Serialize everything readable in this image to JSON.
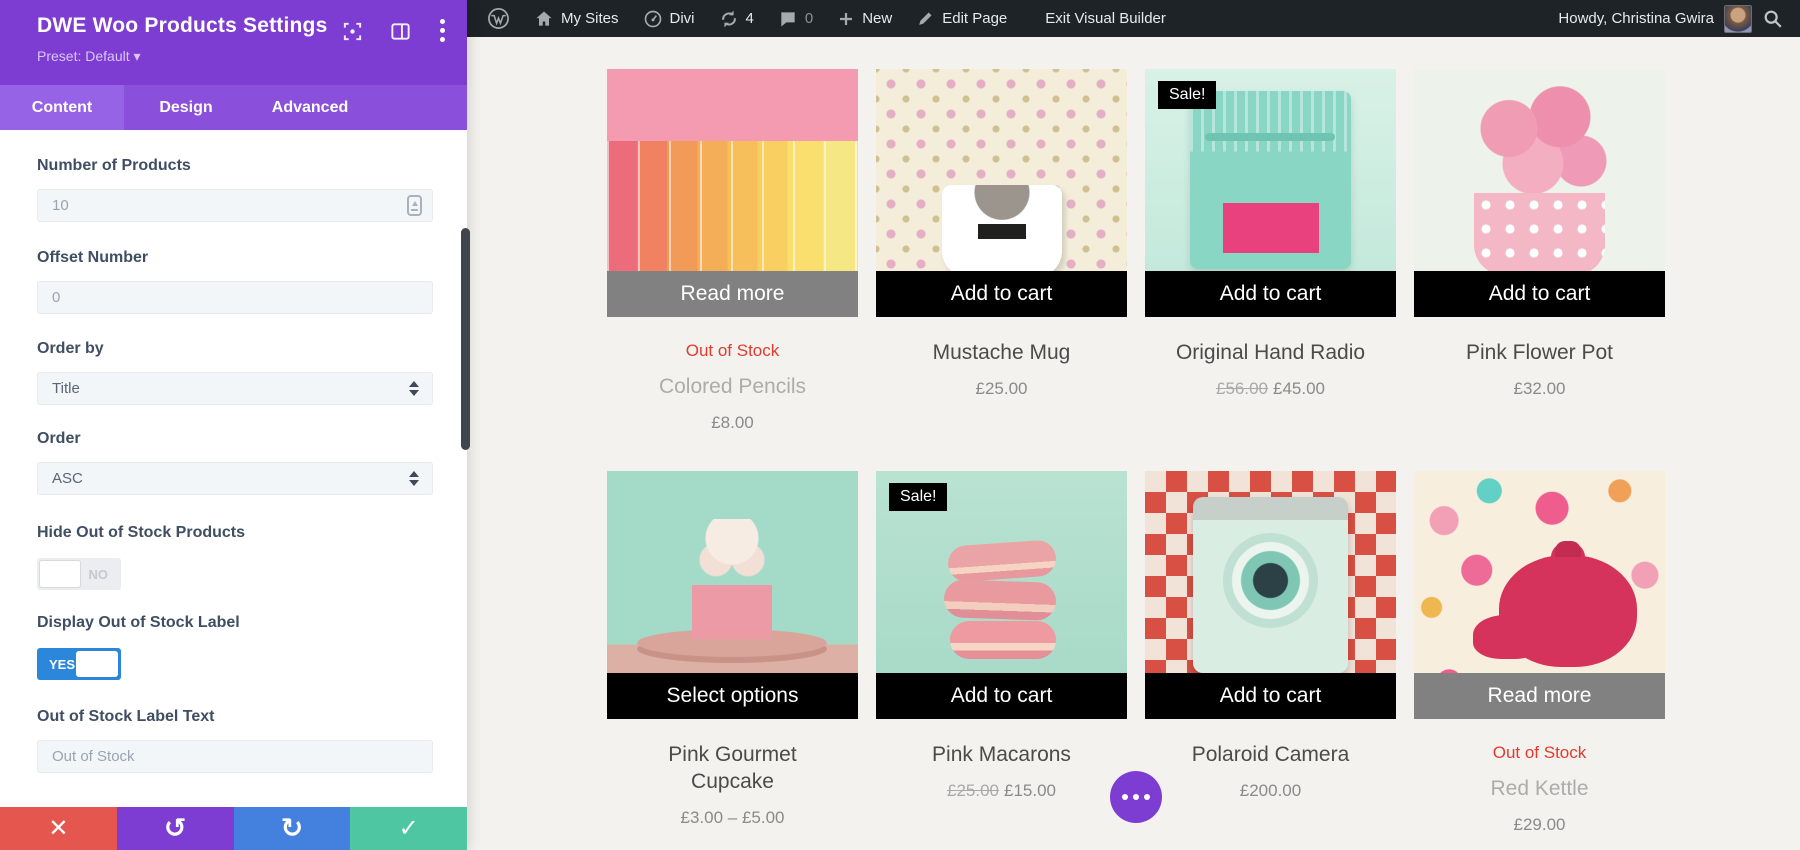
{
  "admin_bar": {
    "my_sites": "My Sites",
    "divi": "Divi",
    "updates_count": "4",
    "comments_count": "0",
    "new_label": "New",
    "edit_page": "Edit Page",
    "exit_visual_builder": "Exit Visual Builder",
    "howdy": "Howdy, Christina Gwira"
  },
  "panel": {
    "title": "DWE Woo Products Settings",
    "preset": "Preset: Default",
    "preset_caret": "▾",
    "tabs": [
      {
        "label": "Content"
      },
      {
        "label": "Design"
      },
      {
        "label": "Advanced"
      }
    ],
    "fields": {
      "number_of_products": {
        "label": "Number of Products",
        "value": "10"
      },
      "offset_number": {
        "label": "Offset Number",
        "value": "0"
      },
      "order_by": {
        "label": "Order by",
        "value": "Title"
      },
      "order": {
        "label": "Order",
        "value": "ASC"
      },
      "hide_out_of_stock": {
        "label": "Hide Out of Stock Products",
        "value": "NO"
      },
      "display_out_of_stock_label": {
        "label": "Display Out of Stock Label",
        "value": "YES"
      },
      "out_of_stock_label_text": {
        "label": "Out of Stock Label Text",
        "value": "Out of Stock"
      }
    },
    "actions": {
      "discard": "✕",
      "undo": "↺",
      "redo": "↻",
      "save": "✓"
    }
  },
  "products": [
    {
      "name": "Colored Pencils",
      "price": "£8.00",
      "button": "Read more",
      "stock_label": "Out of Stock"
    },
    {
      "name": "Mustache Mug",
      "price": "£25.00",
      "button": "Add to cart"
    },
    {
      "name": "Original Hand Radio",
      "price_old": "£56.00",
      "price": "£45.00",
      "button": "Add to cart",
      "sale": "Sale!"
    },
    {
      "name": "Pink Flower Pot",
      "price": "£32.00",
      "button": "Add to cart"
    },
    {
      "name": "Pink Gourmet Cupcake",
      "price": "£3.00 – £5.00",
      "button": "Select options"
    },
    {
      "name": "Pink Macarons",
      "price_old": "£25.00",
      "price": "£15.00",
      "button": "Add to cart",
      "sale": "Sale!"
    },
    {
      "name": "Polaroid Camera",
      "price": "£200.00",
      "button": "Add to cart"
    },
    {
      "name": "Red Kettle",
      "price": "£29.00",
      "button": "Read more",
      "stock_label": "Out of Stock"
    }
  ],
  "colors": {
    "accent_purple": "#7d3cd2",
    "toggle_blue": "#2b87da",
    "discard_red": "#e5574e",
    "redo_blue": "#4480dd",
    "save_green": "#4ec6a1",
    "out_of_stock_red": "#e23a2e"
  }
}
